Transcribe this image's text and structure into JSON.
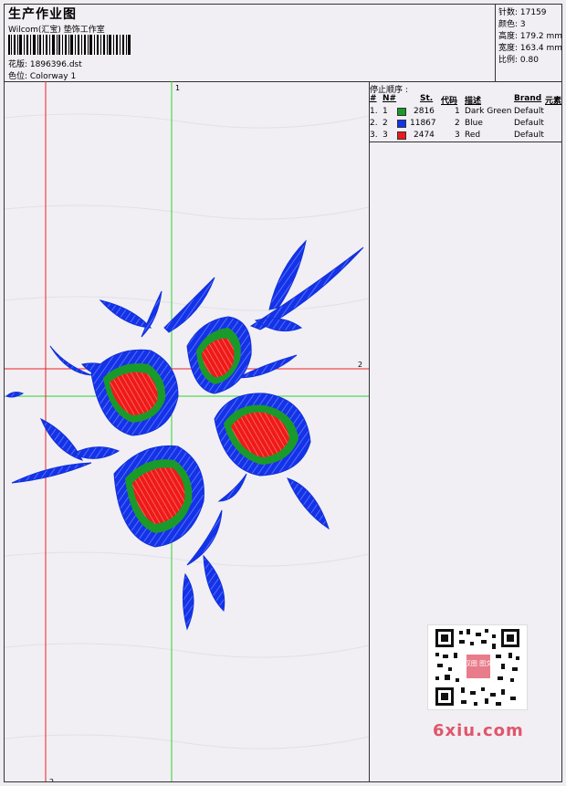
{
  "header": {
    "title": "生产作业图",
    "company": "Wilcom(汇宝) 垫饰工作室",
    "design": "花版: 1896396.dst",
    "colorway": "色位:  Colorway 1"
  },
  "stats": {
    "stitches": "针数:  17159",
    "colors": "颜色:  3",
    "height": "高度:  179.2 mm",
    "width": "宽度:  163.4 mm",
    "scale": "比例:  0.80"
  },
  "stop_sequence": {
    "caption": "停止顺序 :",
    "headers": [
      "#",
      "N#",
      "St.",
      "代码",
      "描述",
      "Brand",
      "元素"
    ],
    "rows": [
      {
        "idx": "1.",
        "n": "1",
        "stitches": "2816",
        "code": "1",
        "desc": "Dark Green",
        "brand": "Default",
        "color": "#1a9a2a"
      },
      {
        "idx": "2.",
        "n": "2",
        "stitches": "11867",
        "code": "2",
        "desc": "Blue",
        "brand": "Default",
        "color": "#1433e8"
      },
      {
        "idx": "3.",
        "n": "3",
        "stitches": "2474",
        "code": "3",
        "desc": "Red",
        "brand": "Default",
        "color": "#ee1a1a"
      }
    ]
  },
  "canvas": {
    "marker_1_top": "1",
    "marker_2_right": "2",
    "marker_2_bottom": "2"
  },
  "watermark": {
    "site": "6xiu.com",
    "qr_badge": "汉图 图文"
  }
}
